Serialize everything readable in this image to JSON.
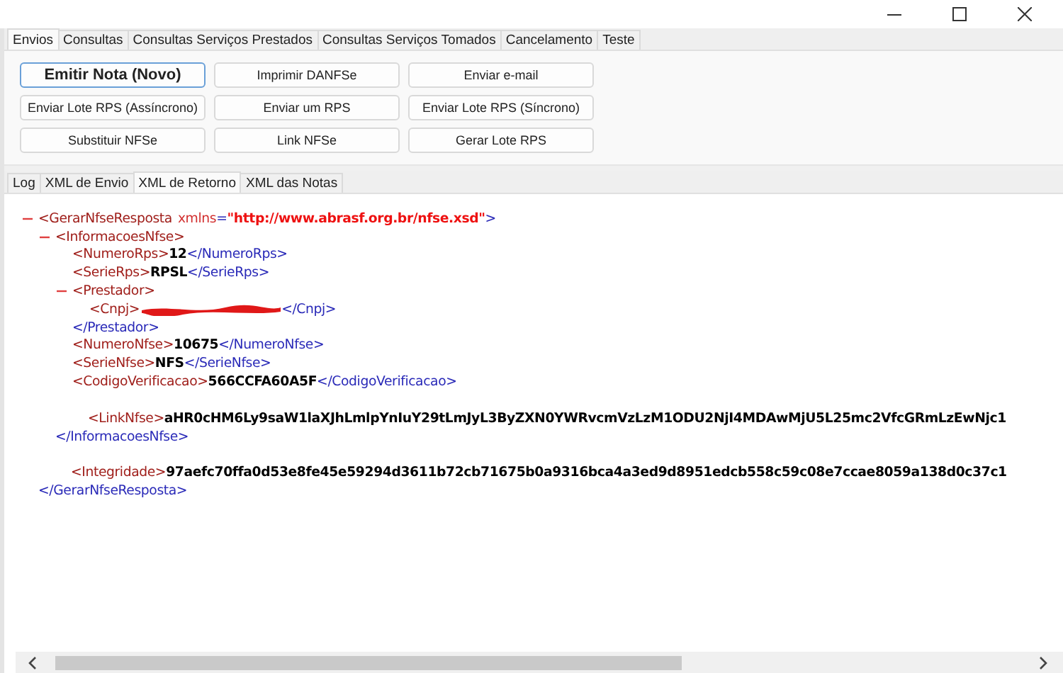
{
  "main_tabs": [
    {
      "label": "Envios",
      "selected": true
    },
    {
      "label": "Consultas",
      "selected": false
    },
    {
      "label": "Consultas Serviços Prestados",
      "selected": false
    },
    {
      "label": "Consultas Serviços Tomados",
      "selected": false
    },
    {
      "label": "Cancelamento",
      "selected": false
    },
    {
      "label": "Teste",
      "selected": false
    }
  ],
  "buttons": [
    {
      "label": "Emitir Nota (Novo)",
      "default": true
    },
    {
      "label": "Imprimir DANFSe",
      "default": false
    },
    {
      "label": "Enviar e-mail",
      "default": false
    },
    {
      "label": "Enviar Lote RPS (Assíncrono)",
      "default": false
    },
    {
      "label": "Enviar um RPS",
      "default": false
    },
    {
      "label": "Enviar Lote RPS (Síncrono)",
      "default": false
    },
    {
      "label": "Substituir NFSe",
      "default": false
    },
    {
      "label": "Link NFSe",
      "default": false
    },
    {
      "label": "Gerar Lote RPS",
      "default": false
    }
  ],
  "output_tabs": [
    {
      "label": "Log",
      "selected": false
    },
    {
      "label": "XML de Envio",
      "selected": false
    },
    {
      "label": "XML de Retorno",
      "selected": true
    },
    {
      "label": "XML das Notas",
      "selected": false
    }
  ],
  "xml": [
    {
      "open": "<GerarNfseResposta",
      "attributes": [
        {
          "name": "xmlns",
          "equals": "=",
          "value": "\"http://www.abrasf.org.br/nfse.xsd\""
        }
      ],
      "open_end": ">",
      "expanded": true,
      "close": "</GerarNfseResposta>",
      "children": [
        {
          "open": "<InformacoesNfse>",
          "expanded": true,
          "close": "</InformacoesNfse>",
          "children": [
            {
              "open": "<NumeroRps>",
              "value": "12",
              "close": "</NumeroRps>"
            },
            {
              "open": "<SerieRps>",
              "value": "RPSL",
              "close": "</SerieRps>"
            },
            {
              "open": "<Prestador>",
              "expanded": true,
              "close": "</Prestador>",
              "children": [
                {
                  "open": "<Cnpj>",
                  "redacted": true,
                  "close": "</Cnpj>"
                }
              ]
            },
            {
              "open": "<NumeroNfse>",
              "value": "10675",
              "close": "</NumeroNfse>"
            },
            {
              "open": "<SerieNfse>",
              "value": "NFS",
              "close": "</SerieNfse>"
            },
            {
              "open": "<CodigoVerificacao>",
              "value": "566CCFA60A5F",
              "close": "</CodigoVerificacao>"
            },
            {
              "open": "<LinkNfse>",
              "value": "aHR0cHM6Ly9saW1laXJhLmlpYnIuY29tLmJyL3ByZXN0YWRvcmVzLzM1ODU2NjI4MDAwMjU5L25mc2VfcGRmLzEwNjc1",
              "gap_before": true,
              "indent_extra": true
            }
          ]
        },
        {
          "open": "<Integridade>",
          "value": "97aefc70ffa0d53e8fe45e59294d3611b72cb71675b0a9316bca4a3ed9d8951edcb558c59c08e7ccae8059a138d0c37c1",
          "gap_before": true,
          "indent_extra": true
        }
      ]
    }
  ]
}
